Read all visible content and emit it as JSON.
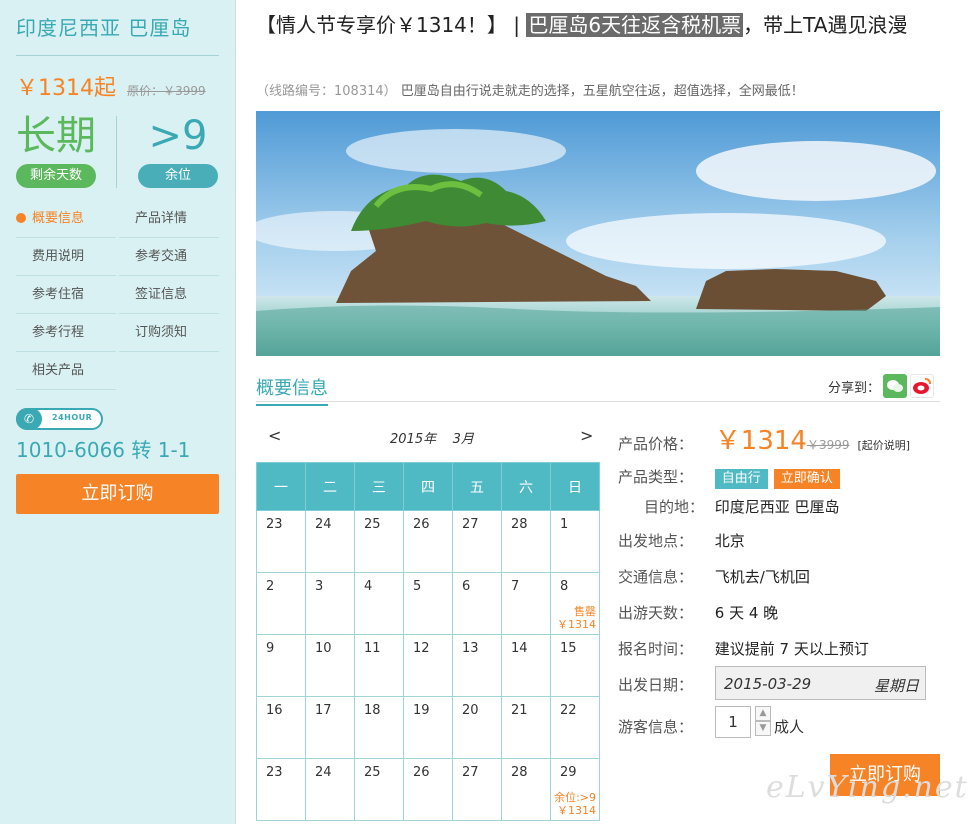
{
  "sidebar": {
    "destination": "印度尼西亚 巴厘岛",
    "price": "￥1314起",
    "original_price_label": "原价：",
    "original_price": "￥3999",
    "stat_duration": "长期",
    "stat_duration_label": "剩余天数",
    "stat_seats": ">9",
    "stat_seats_label": "余位",
    "nav": [
      {
        "label": "概要信息",
        "active": true
      },
      {
        "label": "产品详情"
      },
      {
        "label": "费用说明"
      },
      {
        "label": "参考交通"
      },
      {
        "label": "参考住宿"
      },
      {
        "label": "签证信息"
      },
      {
        "label": "参考行程"
      },
      {
        "label": "订购须知"
      },
      {
        "label": "相关产品"
      }
    ],
    "hotline_badge": "24HOUR",
    "hotline": "1010-6066 转 1-1",
    "book_label": "立即订购"
  },
  "header": {
    "title_part1": "【情人节专享价￥1314！】",
    "title_sep": "|",
    "title_highlight": "巴厘岛6天往返含税机票",
    "title_part2": "，带上TA遇见浪漫",
    "route_code": "（线路编号：108314）",
    "subtitle": "巴厘岛自由行说走就走的选择，五星航空往返，超值选择，全网最低！"
  },
  "section": {
    "title": "概要信息",
    "share_label": "分享到："
  },
  "calendar": {
    "prev": "<",
    "next": ">",
    "year": "2015",
    "year_suffix": "年",
    "month": "3",
    "month_suffix": "月",
    "weekdays": [
      "一",
      "二",
      "三",
      "四",
      "五",
      "六",
      "日"
    ],
    "rows": [
      [
        {
          "d": "23"
        },
        {
          "d": "24"
        },
        {
          "d": "25"
        },
        {
          "d": "26"
        },
        {
          "d": "27"
        },
        {
          "d": "28"
        },
        {
          "d": "1"
        }
      ],
      [
        {
          "d": "2"
        },
        {
          "d": "3"
        },
        {
          "d": "4"
        },
        {
          "d": "5"
        },
        {
          "d": "6"
        },
        {
          "d": "7"
        },
        {
          "d": "8",
          "tag": "售罄",
          "price": "￥1314"
        }
      ],
      [
        {
          "d": "9"
        },
        {
          "d": "10"
        },
        {
          "d": "11"
        },
        {
          "d": "12"
        },
        {
          "d": "13"
        },
        {
          "d": "14"
        },
        {
          "d": "15"
        }
      ],
      [
        {
          "d": "16"
        },
        {
          "d": "17"
        },
        {
          "d": "18"
        },
        {
          "d": "19"
        },
        {
          "d": "20"
        },
        {
          "d": "21"
        },
        {
          "d": "22"
        }
      ],
      [
        {
          "d": "23"
        },
        {
          "d": "24"
        },
        {
          "d": "25"
        },
        {
          "d": "26"
        },
        {
          "d": "27"
        },
        {
          "d": "28"
        },
        {
          "d": "29",
          "tag": "余位:>9",
          "price": "￥1314"
        }
      ]
    ]
  },
  "info": {
    "price_label": "产品价格：",
    "price": "￥1314",
    "price_original": "￥3999",
    "price_note": "[起价说明]",
    "type_label": "产品类型：",
    "type_badges": [
      "自由行",
      "立即确认"
    ],
    "dest_label": "目的地：",
    "dest": "印度尼西亚 巴厘岛",
    "depart_label": "出发地点：",
    "depart": "北京",
    "transport_label": "交通信息：",
    "transport": "飞机去/飞机回",
    "days_label": "出游天数：",
    "days": "6 天 4 晚",
    "signup_label": "报名时间：",
    "signup": "建议提前 7 天以上预订",
    "date_label": "出发日期：",
    "date": "2015-03-29",
    "weekday": "星期日",
    "guest_label": "游客信息：",
    "guest_qty": "1",
    "guest_unit": "成人",
    "book_label": "立即订购"
  },
  "watermark": "eLvYing.net",
  "colors": {
    "accent": "#3aa9b4",
    "orange": "#f68326",
    "green": "#5cb85c",
    "sidebar_bg": "#daf1f3"
  }
}
